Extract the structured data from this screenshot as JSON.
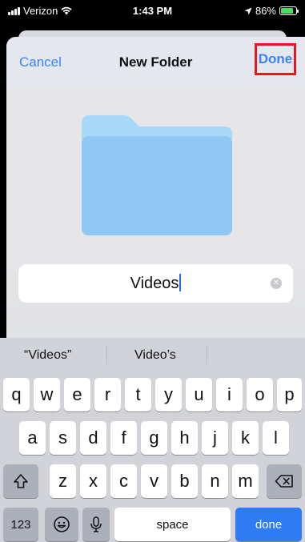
{
  "status_bar": {
    "carrier": "Verizon",
    "time": "1:43 PM",
    "battery": "86%",
    "battery_level": 0.86,
    "icons": [
      "signal-icon",
      "wifi-icon",
      "location-icon",
      "battery-icon"
    ]
  },
  "nav": {
    "cancel": "Cancel",
    "title": "New Folder",
    "done": "Done"
  },
  "folder": {
    "icon": "folder-icon",
    "color": "#8fc9f3"
  },
  "name_field": {
    "value": "Videos",
    "clear_icon": "clear-icon"
  },
  "suggestions": [
    "“Videos”",
    "Video’s",
    ""
  ],
  "keyboard": {
    "row1": [
      "q",
      "w",
      "e",
      "r",
      "t",
      "y",
      "u",
      "i",
      "o",
      "p"
    ],
    "row2": [
      "a",
      "s",
      "d",
      "f",
      "g",
      "h",
      "j",
      "k",
      "l"
    ],
    "row3": [
      "z",
      "x",
      "c",
      "v",
      "b",
      "n",
      "m"
    ],
    "numbers": "123",
    "space": "space",
    "done": "done",
    "emoji_icon": "emoji-icon",
    "mic_icon": "microphone-icon",
    "shift_icon": "shift-icon",
    "delete_icon": "delete-icon"
  },
  "colors": {
    "accent": "#3a82f7",
    "highlight_border": "#e8141f",
    "done_key": "#2f7bf5"
  }
}
